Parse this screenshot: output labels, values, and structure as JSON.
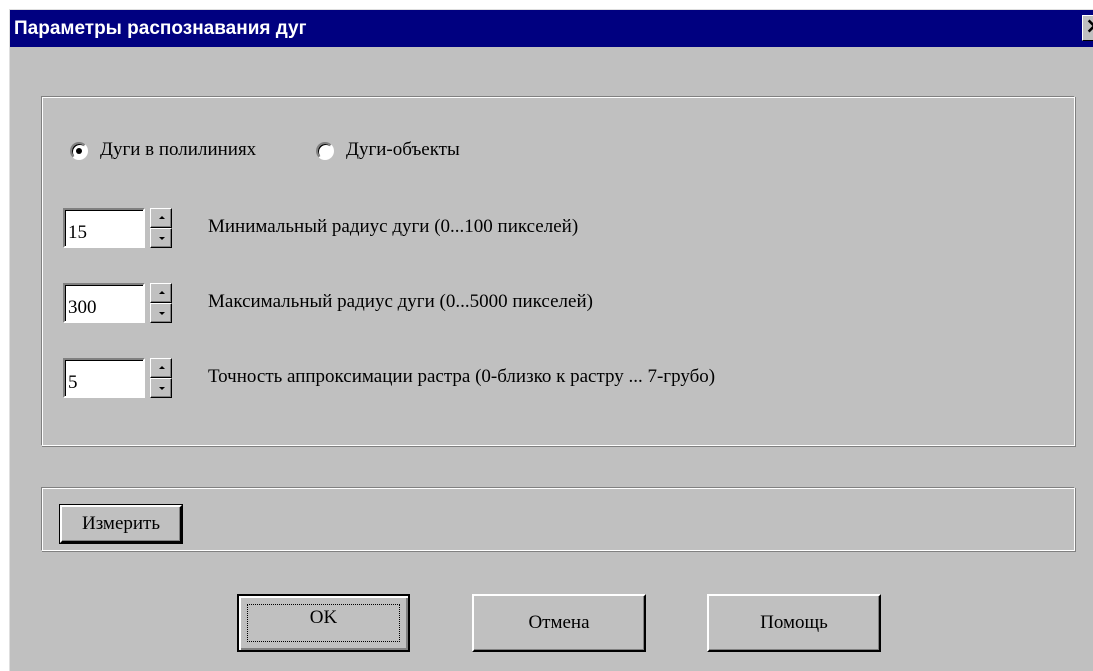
{
  "window": {
    "title": "Параметры распознавания дуг",
    "close_symbol": "×"
  },
  "mode": {
    "options": [
      {
        "label": "Дуги в полилиниях",
        "selected": true
      },
      {
        "label": "Дуги-объекты",
        "selected": false
      }
    ]
  },
  "params": [
    {
      "value": "15",
      "label": "Минимальный  радиус  дуги (0...100 пикселей)"
    },
    {
      "value": "300",
      "label": "Максимальный радиус дуги (0...5000 пикселей)"
    },
    {
      "value": "5",
      "label": "Точность аппроксимации растра (0-близко к растру ... 7-грубо)"
    }
  ],
  "measure": {
    "button_label": "Измерить"
  },
  "buttons": {
    "ok": "OK",
    "cancel": "Отмена",
    "help": "Помощь"
  },
  "colors": {
    "titlebar": "#000080",
    "face": "#c0c0c0"
  },
  "icons": {
    "close": "close-icon",
    "spin_up": "arrow-up-icon",
    "spin_down": "arrow-down-icon"
  }
}
